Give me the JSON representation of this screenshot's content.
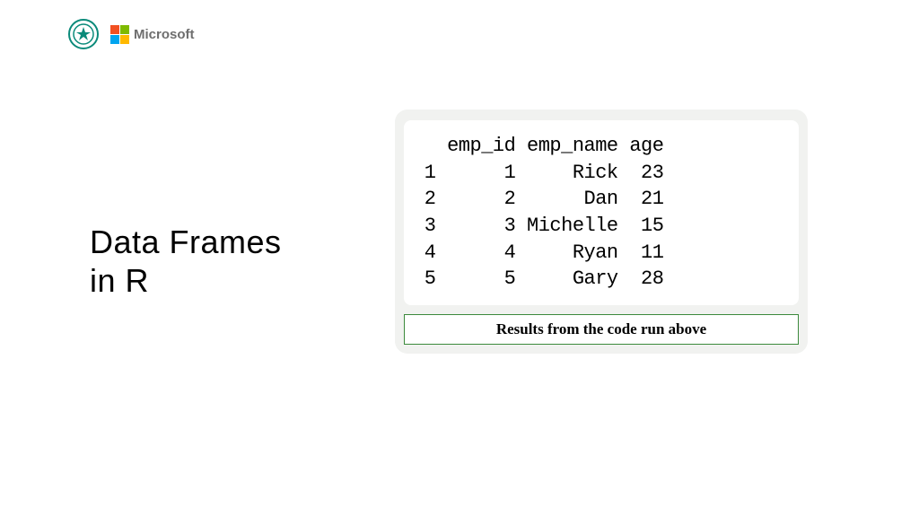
{
  "header": {
    "ms_label": "Microsoft"
  },
  "title_line1": "Data Frames",
  "title_line2": "in R",
  "caption": "Results from the code run above",
  "dataframe": {
    "columns": [
      "emp_id",
      "emp_name",
      "age"
    ],
    "rows": [
      {
        "idx": "1",
        "emp_id": "1",
        "emp_name": "Rick",
        "age": "23"
      },
      {
        "idx": "2",
        "emp_id": "2",
        "emp_name": "Dan",
        "age": "21"
      },
      {
        "idx": "3",
        "emp_id": "3",
        "emp_name": "Michelle",
        "age": "15"
      },
      {
        "idx": "4",
        "emp_id": "4",
        "emp_name": "Ryan",
        "age": "11"
      },
      {
        "idx": "5",
        "emp_id": "5",
        "emp_name": "Gary",
        "age": "28"
      }
    ]
  }
}
